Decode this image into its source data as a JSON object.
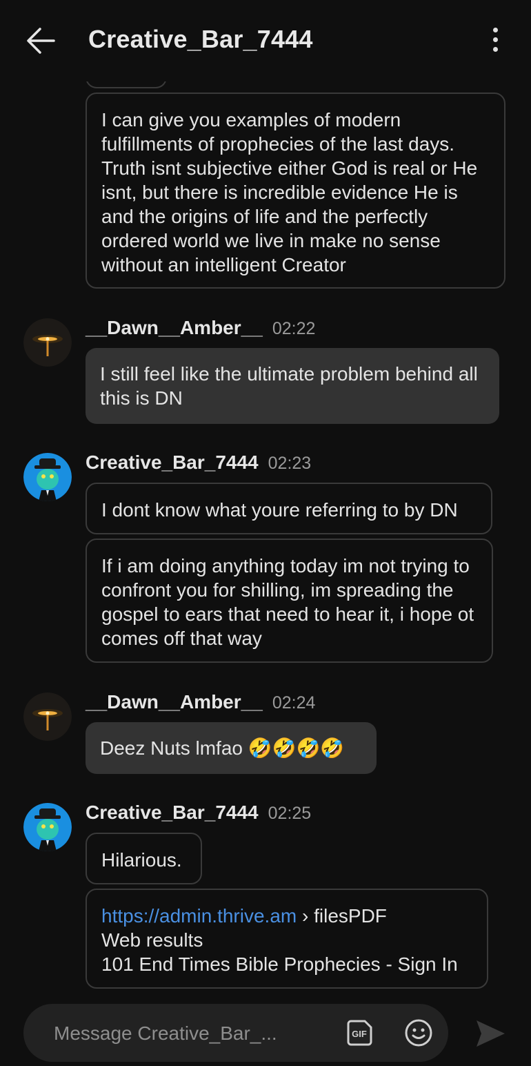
{
  "header": {
    "title": "Creative_Bar_7444"
  },
  "messages": [
    {
      "author": "",
      "time": "",
      "text": "I can give you examples of modern fulfillments of prophecies of the last days. Truth isnt subjective either God is real or He isnt, but there is incredible evidence He is and the origins of life and the perfectly ordered world we live in make no sense without an intelligent Creator"
    },
    {
      "author": "__Dawn__Amber__",
      "time": "02:22",
      "text": "I still feel like the ultimate problem behind all this is DN"
    },
    {
      "author": "Creative_Bar_7444",
      "time": "02:23",
      "text": "I dont know what youre referring to by DN"
    },
    {
      "author": "",
      "time": "",
      "text": "If i am doing anything today im not trying to confront you for shilling, im spreading the gospel to ears that need to hear it, i hope ot comes off that way"
    },
    {
      "author": "__Dawn__Amber__",
      "time": "02:24",
      "text": "Deez Nuts lmfao 🤣🤣🤣🤣"
    },
    {
      "author": "Creative_Bar_7444",
      "time": "02:25",
      "text": "Hilarious."
    },
    {
      "author": "",
      "time": "",
      "link_url": "https://admin.thrive.am",
      "link_rest": " › filesPDF",
      "line2": "Web results",
      "line3": "101 End Times Bible Prophecies - Sign In"
    }
  ],
  "composer": {
    "placeholder": "Message Creative_Bar_..."
  },
  "icons": {
    "back": "arrow-left-icon",
    "more": "more-vertical-icon",
    "gif": "gif-icon",
    "emoji": "smiley-icon",
    "send": "send-icon"
  },
  "colors": {
    "background": "#0f0f0f",
    "outgoing_border": "#3a3a3a",
    "incoming_bubble": "#333333",
    "link": "#4a90e2",
    "timestamp": "#9a9a9a"
  }
}
